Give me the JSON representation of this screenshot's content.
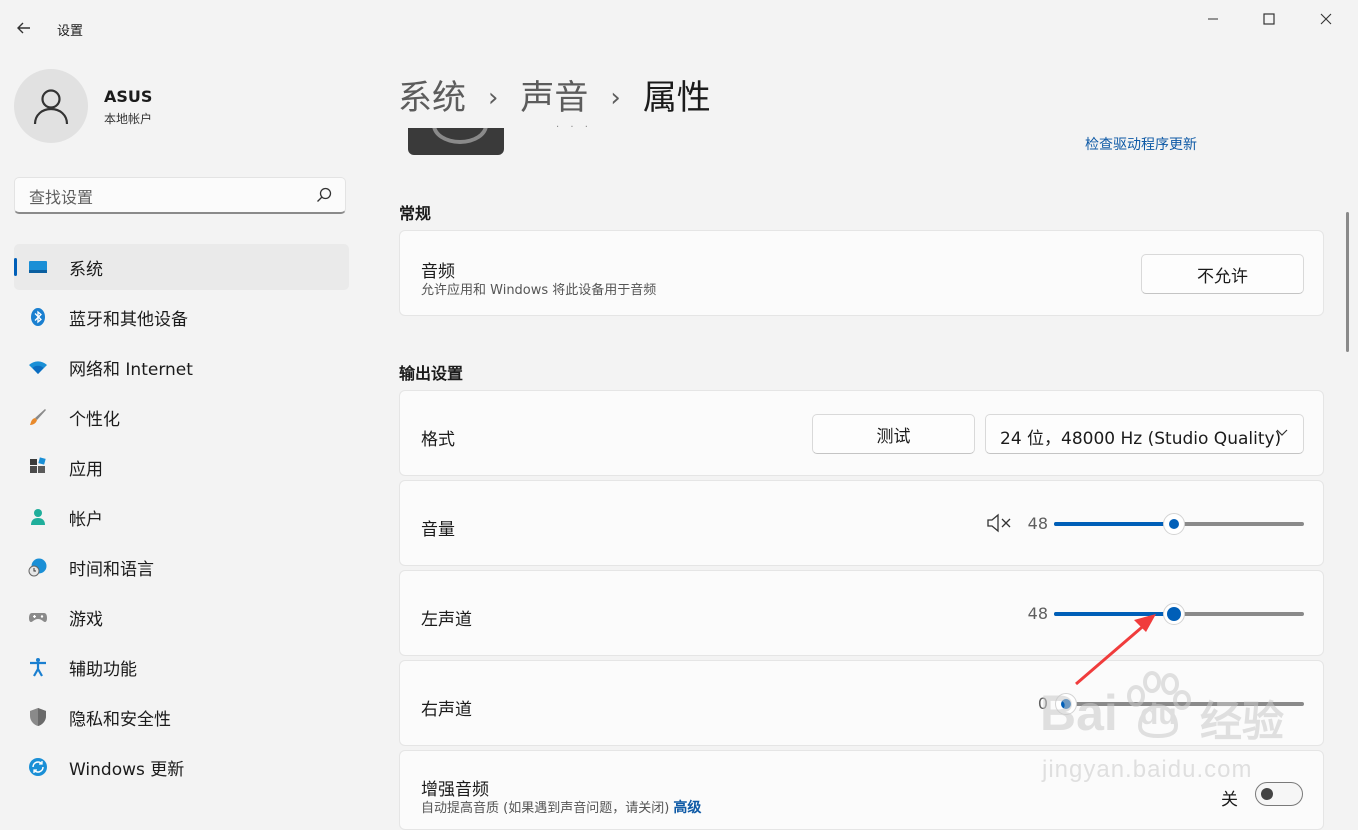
{
  "window": {
    "title": "设置",
    "back_icon": "arrow-left-icon",
    "controls": [
      "minimize-icon",
      "maximize-icon",
      "close-icon"
    ]
  },
  "profile": {
    "name": "ASUS",
    "account_type": "本地帐户"
  },
  "search": {
    "placeholder": "查找设置"
  },
  "sidebar": {
    "items": [
      {
        "label": "系统",
        "icon": "monitor-icon",
        "active": true
      },
      {
        "label": "蓝牙和其他设备",
        "icon": "bluetooth-icon"
      },
      {
        "label": "网络和 Internet",
        "icon": "wifi-icon"
      },
      {
        "label": "个性化",
        "icon": "brush-icon"
      },
      {
        "label": "应用",
        "icon": "apps-icon"
      },
      {
        "label": "帐户",
        "icon": "person-icon"
      },
      {
        "label": "时间和语言",
        "icon": "globe-clock-icon"
      },
      {
        "label": "游戏",
        "icon": "gamepad-icon"
      },
      {
        "label": "辅助功能",
        "icon": "accessibility-icon"
      },
      {
        "label": "隐私和安全性",
        "icon": "shield-icon"
      },
      {
        "label": "Windows 更新",
        "icon": "update-icon"
      }
    ]
  },
  "breadcrumb": {
    "items": [
      "系统",
      "声音"
    ],
    "current": "属性",
    "separator": "›"
  },
  "device": {
    "driver_link": "检查驱动程序更新"
  },
  "general": {
    "section_title": "常规",
    "audio_title": "音频",
    "audio_desc": "允许应用和 Windows 将此设备用于音频",
    "audio_button": "不允许"
  },
  "output": {
    "section_title": "输出设置",
    "format_label": "格式",
    "test_button": "测试",
    "format_value": "24 位，48000 Hz (Studio Quality)",
    "volume_label": "音量",
    "volume_value": "48",
    "volume_fraction": 0.48,
    "mute_icon": "speaker-mute-icon",
    "left_label": "左声道",
    "left_value": "48",
    "left_fraction": 0.48,
    "right_label": "右声道",
    "right_value": "0",
    "right_fraction": 0.0,
    "enhance_title": "增强音频",
    "enhance_desc": "自动提高音质 (如果遇到声音问题，请关闭)",
    "enhance_advanced": "高级",
    "enhance_state": "关"
  },
  "watermark": {
    "brand_a": "Bai",
    "brand_b": "du",
    "brand_c": "经验",
    "url": "jingyan.baidu.com"
  },
  "colors": {
    "accent": "#005fb8",
    "link": "#0f5aa6",
    "annotation_arrow": "#f03c3c"
  }
}
